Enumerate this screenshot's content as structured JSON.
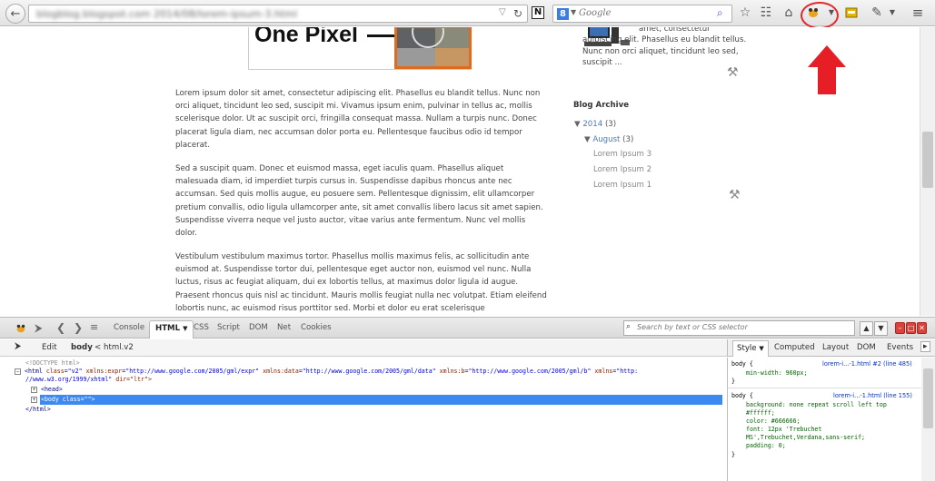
{
  "browser": {
    "url": "blogblog.blogspot.com 2014/08/lorem-ipsum-3.html",
    "search_placeholder": "Google",
    "search_engine_icon": "google-icon"
  },
  "page": {
    "hero_title": "One Pixel",
    "paragraphs": [
      "Lorem ipsum dolor sit amet, consectetur adipiscing elit. Phasellus eu blandit tellus. Nunc non orci aliquet, tincidunt leo sed, suscipit mi. Vivamus ipsum enim, pulvinar in tellus ac, mollis scelerisque dolor. Ut ac suscipit orci, fringilla consequat massa. Nullam a turpis nunc. Donec placerat ligula diam, nec accumsan dolor porta eu. Pellentesque faucibus odio id tempor placerat.",
      "Sed a suscipit quam. Donec et euismod massa, eget iaculis quam. Phasellus aliquet malesuada diam, id imperdiet turpis cursus in. Suspendisse dapibus rhoncus ante nec accumsan. Sed quis mollis augue, eu posuere sem. Pellentesque dignissim, elit ullamcorper pretium convallis, odio ligula ullamcorper ante, sit amet convallis libero lacus sit amet sapien. Suspendisse viverra neque vel justo auctor, vitae varius ante fermentum. Nunc vel mollis dolor.",
      "Vestibulum vestibulum maximus tortor. Phasellus mollis maximus felis, ac sollicitudin ante euismod at. Suspendisse tortor dui, pellentesque eget auctor non, euismod vel nunc. Nulla luctus, risus ac feugiat aliquam, dui ex lobortis tellus, at maximus dolor ligula id augue. Praesent rhoncus quis nisl ac tincidunt. Mauris mollis feugiat nulla nec volutpat. Etiam eleifend lobortis nunc, ac euismod risus porttitor sed. Morbi et dolor eu erat scelerisque"
    ],
    "sidebar_snippet": "amet, consectetur adipiscing elit. Phasellus eu blandit tellus. Nunc non orci aliquet, tincidunt leo sed, suscipit ...",
    "archive": {
      "title": "Blog Archive",
      "year": "2014",
      "year_count": "(3)",
      "month": "August",
      "month_count": "(3)",
      "posts": [
        "Lorem Ipsum 3",
        "Lorem Ipsum 2",
        "Lorem Ipsum 1"
      ]
    }
  },
  "firebug": {
    "tabs": [
      "Console",
      "HTML",
      "CSS",
      "Script",
      "DOM",
      "Net",
      "Cookies"
    ],
    "search_placeholder": "Search by text or CSS selector",
    "breadcrumb": {
      "edit": "Edit",
      "body": "body",
      "sep": "<",
      "html": "html.v2"
    },
    "side_tabs": [
      "Style",
      "Computed",
      "Layout",
      "DOM",
      "Events"
    ],
    "code": {
      "doctype": "<!DOCTYPE html>",
      "html_tag_open": "<html",
      "html_attrs": [
        {
          "name": "class",
          "value": "\"v2\""
        },
        {
          "name": "xmlns:expr",
          "value": "\"http://www.google.com/2005/gml/expr\""
        },
        {
          "name": "xmlns:data",
          "value": "\"http://www.google.com/2005/gml/data\""
        },
        {
          "name": "xmlns:b",
          "value": "\"http://www.google.com/2005/gml/b\""
        },
        {
          "name": "xmlns",
          "value": "\"http:"
        }
      ],
      "html_line2": "//www.w3.org/1999/xhtml\"",
      "html_dir": "dir=\"ltr\">",
      "head": "<head>",
      "body": "<body class=\"\">",
      "html_close": "</html>"
    },
    "css_rules": [
      {
        "selector": "body {",
        "link": "lorem-i...-1.html #2 (line 485)",
        "decls": [
          "min-width: 960px;"
        ],
        "close": "}"
      },
      {
        "selector": "body {",
        "link": "lorem-i...-1.html (line 155)",
        "decls": [
          "background: none repeat scroll left top",
          "  #ffffff;",
          "color: #666666;",
          "font: 12px 'Trebuchet",
          "  MS',Trebuchet,Verdana,sans-serif;",
          "padding: 0;"
        ],
        "close": "}"
      }
    ]
  }
}
